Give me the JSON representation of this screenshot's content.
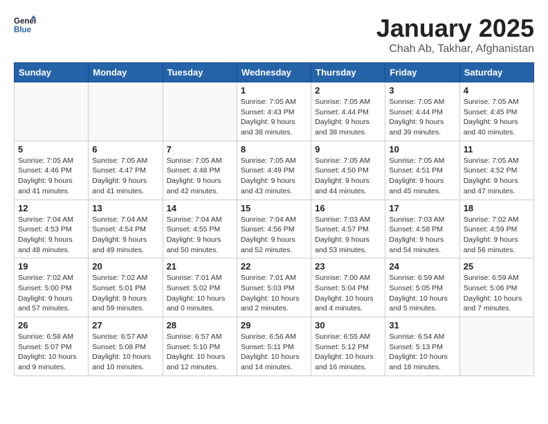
{
  "header": {
    "logo_general": "General",
    "logo_blue": "Blue",
    "title": "January 2025",
    "subtitle": "Chah Ab, Takhar, Afghanistan"
  },
  "weekdays": [
    "Sunday",
    "Monday",
    "Tuesday",
    "Wednesday",
    "Thursday",
    "Friday",
    "Saturday"
  ],
  "weeks": [
    [
      {
        "day": "",
        "info": ""
      },
      {
        "day": "",
        "info": ""
      },
      {
        "day": "",
        "info": ""
      },
      {
        "day": "1",
        "info": "Sunrise: 7:05 AM\nSunset: 4:43 PM\nDaylight: 9 hours\nand 38 minutes."
      },
      {
        "day": "2",
        "info": "Sunrise: 7:05 AM\nSunset: 4:44 PM\nDaylight: 9 hours\nand 38 minutes."
      },
      {
        "day": "3",
        "info": "Sunrise: 7:05 AM\nSunset: 4:44 PM\nDaylight: 9 hours\nand 39 minutes."
      },
      {
        "day": "4",
        "info": "Sunrise: 7:05 AM\nSunset: 4:45 PM\nDaylight: 9 hours\nand 40 minutes."
      }
    ],
    [
      {
        "day": "5",
        "info": "Sunrise: 7:05 AM\nSunset: 4:46 PM\nDaylight: 9 hours\nand 41 minutes."
      },
      {
        "day": "6",
        "info": "Sunrise: 7:05 AM\nSunset: 4:47 PM\nDaylight: 9 hours\nand 41 minutes."
      },
      {
        "day": "7",
        "info": "Sunrise: 7:05 AM\nSunset: 4:48 PM\nDaylight: 9 hours\nand 42 minutes."
      },
      {
        "day": "8",
        "info": "Sunrise: 7:05 AM\nSunset: 4:49 PM\nDaylight: 9 hours\nand 43 minutes."
      },
      {
        "day": "9",
        "info": "Sunrise: 7:05 AM\nSunset: 4:50 PM\nDaylight: 9 hours\nand 44 minutes."
      },
      {
        "day": "10",
        "info": "Sunrise: 7:05 AM\nSunset: 4:51 PM\nDaylight: 9 hours\nand 45 minutes."
      },
      {
        "day": "11",
        "info": "Sunrise: 7:05 AM\nSunset: 4:52 PM\nDaylight: 9 hours\nand 47 minutes."
      }
    ],
    [
      {
        "day": "12",
        "info": "Sunrise: 7:04 AM\nSunset: 4:53 PM\nDaylight: 9 hours\nand 48 minutes."
      },
      {
        "day": "13",
        "info": "Sunrise: 7:04 AM\nSunset: 4:54 PM\nDaylight: 9 hours\nand 49 minutes."
      },
      {
        "day": "14",
        "info": "Sunrise: 7:04 AM\nSunset: 4:55 PM\nDaylight: 9 hours\nand 50 minutes."
      },
      {
        "day": "15",
        "info": "Sunrise: 7:04 AM\nSunset: 4:56 PM\nDaylight: 9 hours\nand 52 minutes."
      },
      {
        "day": "16",
        "info": "Sunrise: 7:03 AM\nSunset: 4:57 PM\nDaylight: 9 hours\nand 53 minutes."
      },
      {
        "day": "17",
        "info": "Sunrise: 7:03 AM\nSunset: 4:58 PM\nDaylight: 9 hours\nand 54 minutes."
      },
      {
        "day": "18",
        "info": "Sunrise: 7:02 AM\nSunset: 4:59 PM\nDaylight: 9 hours\nand 56 minutes."
      }
    ],
    [
      {
        "day": "19",
        "info": "Sunrise: 7:02 AM\nSunset: 5:00 PM\nDaylight: 9 hours\nand 57 minutes."
      },
      {
        "day": "20",
        "info": "Sunrise: 7:02 AM\nSunset: 5:01 PM\nDaylight: 9 hours\nand 59 minutes."
      },
      {
        "day": "21",
        "info": "Sunrise: 7:01 AM\nSunset: 5:02 PM\nDaylight: 10 hours\nand 0 minutes."
      },
      {
        "day": "22",
        "info": "Sunrise: 7:01 AM\nSunset: 5:03 PM\nDaylight: 10 hours\nand 2 minutes."
      },
      {
        "day": "23",
        "info": "Sunrise: 7:00 AM\nSunset: 5:04 PM\nDaylight: 10 hours\nand 4 minutes."
      },
      {
        "day": "24",
        "info": "Sunrise: 6:59 AM\nSunset: 5:05 PM\nDaylight: 10 hours\nand 5 minutes."
      },
      {
        "day": "25",
        "info": "Sunrise: 6:59 AM\nSunset: 5:06 PM\nDaylight: 10 hours\nand 7 minutes."
      }
    ],
    [
      {
        "day": "26",
        "info": "Sunrise: 6:58 AM\nSunset: 5:07 PM\nDaylight: 10 hours\nand 9 minutes."
      },
      {
        "day": "27",
        "info": "Sunrise: 6:57 AM\nSunset: 5:08 PM\nDaylight: 10 hours\nand 10 minutes."
      },
      {
        "day": "28",
        "info": "Sunrise: 6:57 AM\nSunset: 5:10 PM\nDaylight: 10 hours\nand 12 minutes."
      },
      {
        "day": "29",
        "info": "Sunrise: 6:56 AM\nSunset: 5:11 PM\nDaylight: 10 hours\nand 14 minutes."
      },
      {
        "day": "30",
        "info": "Sunrise: 6:55 AM\nSunset: 5:12 PM\nDaylight: 10 hours\nand 16 minutes."
      },
      {
        "day": "31",
        "info": "Sunrise: 6:54 AM\nSunset: 5:13 PM\nDaylight: 10 hours\nand 18 minutes."
      },
      {
        "day": "",
        "info": ""
      }
    ]
  ]
}
